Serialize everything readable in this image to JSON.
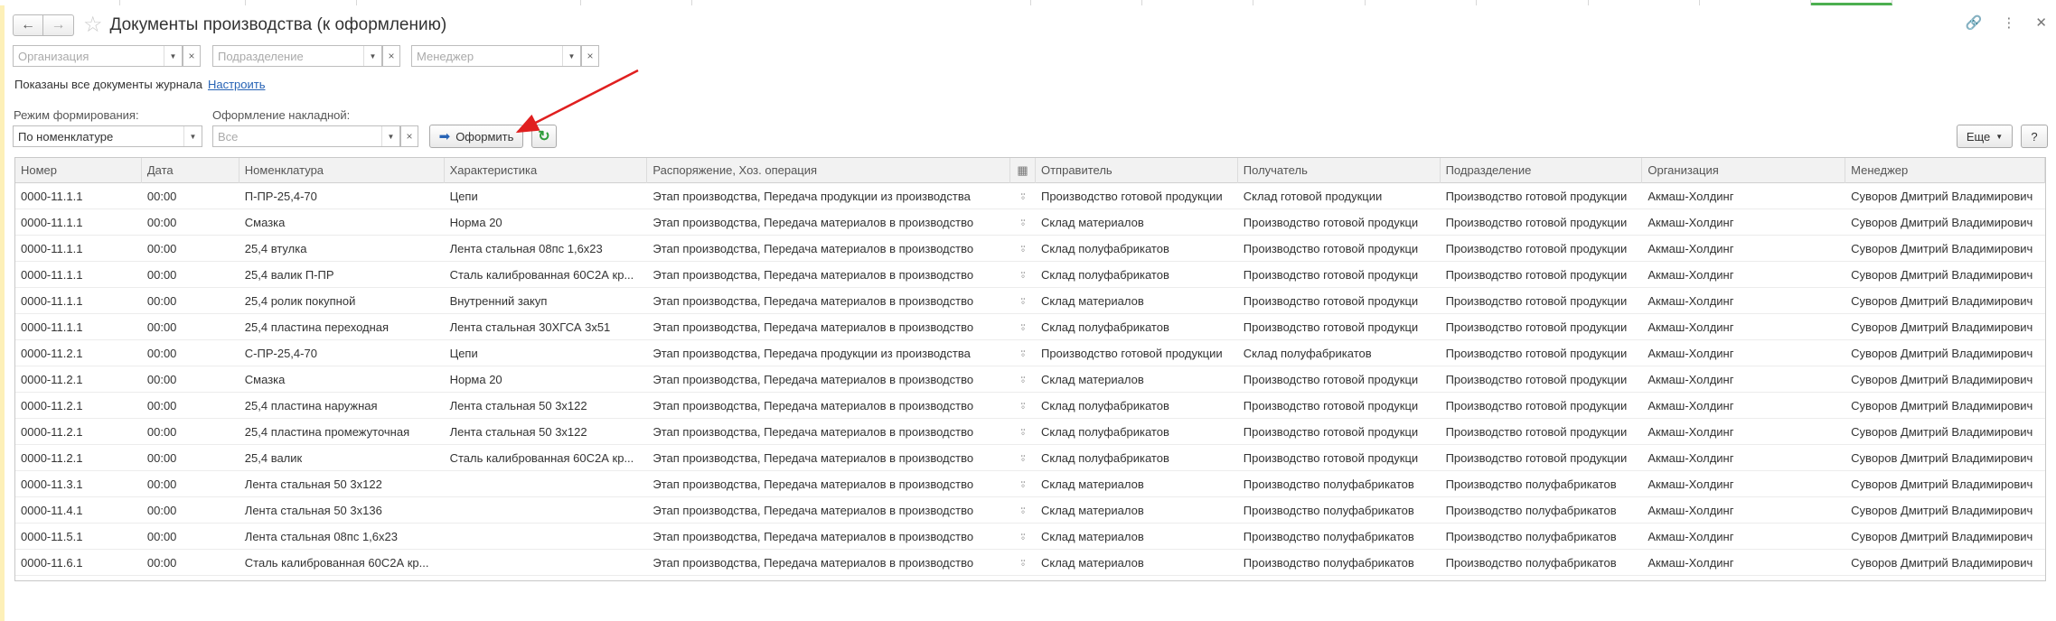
{
  "window": {
    "title": "Документы производства (к оформлению)"
  },
  "filters": {
    "organization_placeholder": "Организация",
    "division_placeholder": "Подразделение",
    "manager_placeholder": "Менеджер"
  },
  "info": {
    "text": "Показаны все документы журнала",
    "link": "Настроить"
  },
  "controls": {
    "mode_label": "Режим формирования:",
    "mode_value": "По номенклатуре",
    "invoice_label": "Оформление накладной:",
    "invoice_placeholder": "Все",
    "process_button": "Оформить",
    "more_button": "Еще",
    "help_button": "?"
  },
  "table": {
    "columns": [
      "Номер",
      "Дата",
      "Номенклатура",
      "Характеристика",
      "Распоряжение, Хоз. операция",
      "",
      "Отправитель",
      "Получатель",
      "Подразделение",
      "Организация",
      "Менеджер"
    ],
    "rows": [
      [
        "0000-11.1.1",
        "00:00",
        "П-ПР-25,4-70",
        "Цепи",
        "Этап производства, Передача продукции из производства",
        "",
        "Производство готовой продукции",
        "Склад готовой продукции",
        "Производство готовой продукции",
        "Акмаш-Холдинг",
        "Суворов Дмитрий Владимирович"
      ],
      [
        "0000-11.1.1",
        "00:00",
        "Смазка",
        "Норма 20",
        "Этап производства, Передача материалов в производство",
        "",
        "Склад материалов",
        "Производство готовой продукци",
        "Производство готовой продукции",
        "Акмаш-Холдинг",
        "Суворов Дмитрий Владимирович"
      ],
      [
        "0000-11.1.1",
        "00:00",
        "25,4 втулка",
        "Лента стальная 08пс 1,6х23",
        "Этап производства, Передача материалов в производство",
        "",
        "Склад полуфабрикатов",
        "Производство готовой продукци",
        "Производство готовой продукции",
        "Акмаш-Холдинг",
        "Суворов Дмитрий Владимирович"
      ],
      [
        "0000-11.1.1",
        "00:00",
        "25,4 валик П-ПР",
        "Сталь калиброванная 60С2А кр...",
        "Этап производства, Передача материалов в производство",
        "",
        "Склад полуфабрикатов",
        "Производство готовой продукци",
        "Производство готовой продукции",
        "Акмаш-Холдинг",
        "Суворов Дмитрий Владимирович"
      ],
      [
        "0000-11.1.1",
        "00:00",
        "25,4 ролик покупной",
        "Внутренний закуп",
        "Этап производства, Передача материалов в производство",
        "",
        "Склад материалов",
        "Производство готовой продукци",
        "Производство готовой продукции",
        "Акмаш-Холдинг",
        "Суворов Дмитрий Владимирович"
      ],
      [
        "0000-11.1.1",
        "00:00",
        "25,4 пластина переходная",
        "Лента стальная 30ХГСА 3х51",
        "Этап производства, Передача материалов в производство",
        "",
        "Склад полуфабрикатов",
        "Производство готовой продукци",
        "Производство готовой продукции",
        "Акмаш-Холдинг",
        "Суворов Дмитрий Владимирович"
      ],
      [
        "0000-11.2.1",
        "00:00",
        "С-ПР-25,4-70",
        "Цепи",
        "Этап производства, Передача продукции из производства",
        "",
        "Производство готовой продукции",
        "Склад полуфабрикатов",
        "Производство готовой продукции",
        "Акмаш-Холдинг",
        "Суворов Дмитрий Владимирович"
      ],
      [
        "0000-11.2.1",
        "00:00",
        "Смазка",
        "Норма 20",
        "Этап производства, Передача материалов в производство",
        "",
        "Склад материалов",
        "Производство готовой продукци",
        "Производство готовой продукции",
        "Акмаш-Холдинг",
        "Суворов Дмитрий Владимирович"
      ],
      [
        "0000-11.2.1",
        "00:00",
        "25,4 пластина наружная",
        "Лента стальная 50 3х122",
        "Этап производства, Передача материалов в производство",
        "",
        "Склад полуфабрикатов",
        "Производство готовой продукци",
        "Производство готовой продукции",
        "Акмаш-Холдинг",
        "Суворов Дмитрий Владимирович"
      ],
      [
        "0000-11.2.1",
        "00:00",
        "25,4 пластина промежуточная",
        "Лента стальная 50 3х122",
        "Этап производства, Передача материалов в производство",
        "",
        "Склад полуфабрикатов",
        "Производство готовой продукци",
        "Производство готовой продукции",
        "Акмаш-Холдинг",
        "Суворов Дмитрий Владимирович"
      ],
      [
        "0000-11.2.1",
        "00:00",
        "25,4 валик",
        "Сталь калиброванная 60С2А кр...",
        "Этап производства, Передача материалов в производство",
        "",
        "Склад полуфабрикатов",
        "Производство готовой продукци",
        "Производство готовой продукции",
        "Акмаш-Холдинг",
        "Суворов Дмитрий Владимирович"
      ],
      [
        "0000-11.3.1",
        "00:00",
        "Лента стальная 50 3х122",
        "",
        "Этап производства, Передача материалов в производство",
        "",
        "Склад материалов",
        "Производство полуфабрикатов",
        "Производство полуфабрикатов",
        "Акмаш-Холдинг",
        "Суворов Дмитрий Владимирович"
      ],
      [
        "0000-11.4.1",
        "00:00",
        "Лента стальная 50 3х136",
        "",
        "Этап производства, Передача материалов в производство",
        "",
        "Склад материалов",
        "Производство полуфабрикатов",
        "Производство полуфабрикатов",
        "Акмаш-Холдинг",
        "Суворов Дмитрий Владимирович"
      ],
      [
        "0000-11.5.1",
        "00:00",
        "Лента стальная 08пс 1,6х23",
        "",
        "Этап производства, Передача материалов в производство",
        "",
        "Склад материалов",
        "Производство полуфабрикатов",
        "Производство полуфабрикатов",
        "Акмаш-Холдинг",
        "Суворов Дмитрий Владимирович"
      ],
      [
        "0000-11.6.1",
        "00:00",
        "Сталь калиброванная 60С2А кр...",
        "",
        "Этап производства, Передача материалов в производство",
        "",
        "Склад материалов",
        "Производство полуфабрикатов",
        "Производство полуфабрикатов",
        "Акмаш-Холдинг",
        "Суворов Дмитрий Владимирович"
      ]
    ]
  },
  "icons": {
    "back": "arrow-left-icon",
    "forward": "arrow-right-icon",
    "favorite": "star-icon",
    "link": "link-icon",
    "menu": "more-vertical-icon",
    "close": "close-icon",
    "refresh": "refresh-icon",
    "process": "arrow-right-icon",
    "row_type": "document-type-icon",
    "column_settings": "columns-icon"
  },
  "colors": {
    "accent": "#2763b5",
    "annotation_arrow": "#e01f1f",
    "refresh_icon": "#2e9c3a",
    "left_bar": "#fdf0b8"
  }
}
